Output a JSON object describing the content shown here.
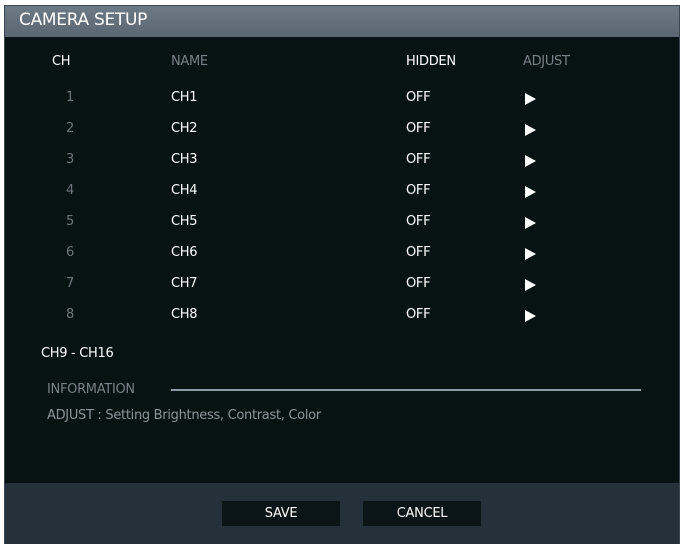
{
  "window": {
    "title": "CAMERA SETUP"
  },
  "columns": {
    "ch": "CH",
    "name": "NAME",
    "hidden": "HIDDEN",
    "adjust": "ADJUST"
  },
  "channels": [
    {
      "num": "1",
      "name": "CH1",
      "hidden": "OFF"
    },
    {
      "num": "2",
      "name": "CH2",
      "hidden": "OFF"
    },
    {
      "num": "3",
      "name": "CH3",
      "hidden": "OFF"
    },
    {
      "num": "4",
      "name": "CH4",
      "hidden": "OFF"
    },
    {
      "num": "5",
      "name": "CH5",
      "hidden": "OFF"
    },
    {
      "num": "6",
      "name": "CH6",
      "hidden": "OFF"
    },
    {
      "num": "7",
      "name": "CH7",
      "hidden": "OFF"
    },
    {
      "num": "8",
      "name": "CH8",
      "hidden": "OFF"
    }
  ],
  "adjust_icon": "play-arrow-icon",
  "range_label": "CH9 - CH16",
  "information": {
    "label": "INFORMATION",
    "text": "ADJUST : Setting Brightness, Contrast, Color"
  },
  "footer": {
    "save_label": "SAVE",
    "cancel_label": "CANCEL"
  },
  "colors": {
    "background": "#071312",
    "titlebar": "#5f6b77",
    "footer": "#24303a",
    "text_primary": "#ffffff",
    "text_muted": "#7a8088"
  }
}
